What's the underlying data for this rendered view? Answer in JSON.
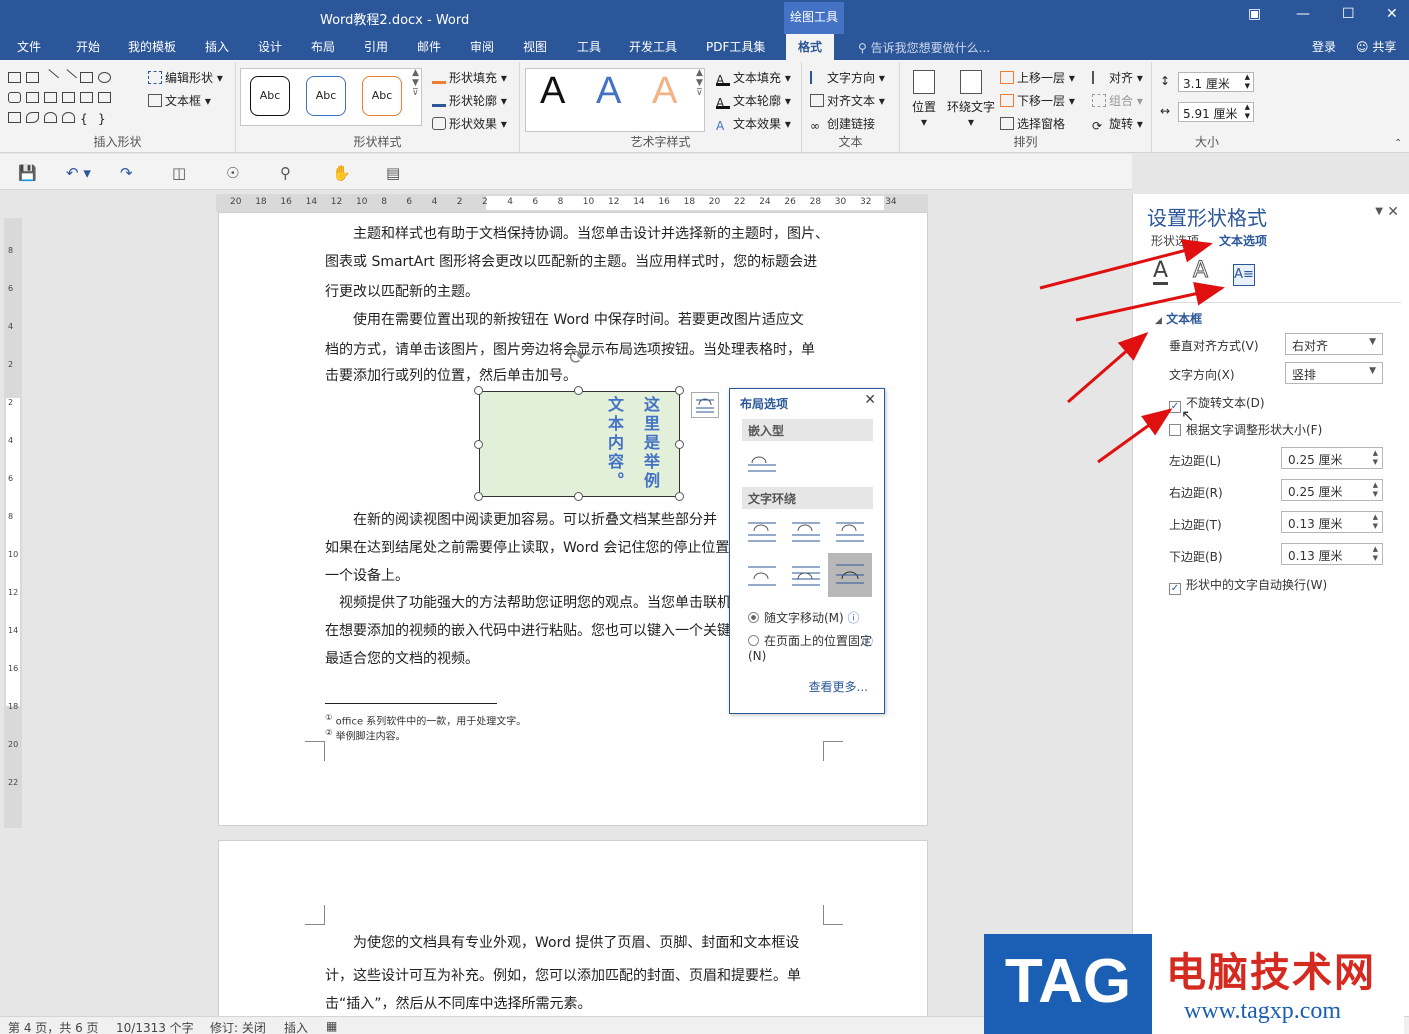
{
  "window": {
    "title": "Word教程2.docx - Word",
    "context_tab": "绘图工具",
    "controls": [
      "restore-ribbon",
      "minimize",
      "maximize",
      "close"
    ]
  },
  "tabs": [
    "文件",
    "开始",
    "我的模板",
    "插入",
    "设计",
    "布局",
    "引用",
    "邮件",
    "审阅",
    "视图",
    "工具",
    "开发工具",
    "PDF工具集",
    "格式"
  ],
  "active_tab": "格式",
  "tell_me": "告诉我您想要做什么...",
  "account": {
    "login": "登录",
    "share": "共享"
  },
  "ribbon": {
    "insert_shapes": {
      "label": "插入形状",
      "edit_shape": "编辑形状",
      "text_box": "文本框"
    },
    "shape_styles": {
      "label": "形状样式",
      "sample": "Abc",
      "fill": "形状填充",
      "outline": "形状轮廓",
      "effects": "形状效果"
    },
    "wordart": {
      "label": "艺术字样式",
      "sample": "A",
      "fill": "文本填充",
      "outline": "文本轮廓",
      "effects": "文本效果"
    },
    "text": {
      "label": "文本",
      "direction": "文字方向",
      "align": "对齐文本",
      "link": "创建链接"
    },
    "arrange": {
      "label": "排列",
      "position": "位置",
      "wrap": "环绕文字",
      "forward": "上移一层",
      "backward": "下移一层",
      "pane": "选择窗格",
      "align": "对齐",
      "group": "组合",
      "rotate": "旋转"
    },
    "size": {
      "label": "大小",
      "height": "3.1 厘米",
      "width": "5.91 厘米"
    }
  },
  "ruler": {
    "h_numbers": [
      "20",
      "18",
      "16",
      "14",
      "12",
      "10",
      "8",
      "6",
      "4",
      "2",
      "2",
      "4",
      "6",
      "8",
      "10",
      "12",
      "14",
      "16",
      "18",
      "20",
      "22",
      "24",
      "26",
      "28",
      "30",
      "32",
      "34"
    ],
    "v_numbers": [
      "8",
      "6",
      "4",
      "2",
      "2",
      "4",
      "6",
      "8",
      "10",
      "12",
      "14",
      "16",
      "18",
      "20",
      "22"
    ]
  },
  "document": {
    "page1": {
      "lines": [
        "主题和样式也有助于文档保持协调。当您单击设计并选择新的主题时，图片、",
        "图表或 SmartArt 图形将会更改以匹配新的主题。当应用样式时，您的标题会进",
        "行更改以匹配新的主题。",
        "使用在需要位置出现的新按钮在 Word 中保存时间。若要更改图片适应文",
        "档的方式，请单击该图片，图片旁边将会显示布局选项按钮。当处理表格时，单",
        "击要添加行或列的位置，然后单击加号。",
        "在新的阅读视图中阅读更加容易。可以折叠文档某些部分并",
        "如果在达到结尾处之前需要停止读取，Word 会记住您的停止位置",
        "一个设备上。",
        "视频提供了功能强大的方法帮助您证明您的观点。当您单击联机",
        "在想要添加的视频的嵌入代码中进行粘贴。您也可以键入一个关键",
        "最适合您的文档的视频。"
      ],
      "footnotes": [
        "office 系列软件中的一款，用于处理文字。",
        "举例脚注内容。"
      ],
      "textbox": {
        "col1": "这里是举例",
        "col2": "文本内容。"
      }
    },
    "page2": {
      "lines": [
        "为使您的文档具有专业外观，Word 提供了页眉、页脚、封面和文本框设",
        "计，这些设计可互为补充。例如，您可以添加匹配的封面、页眉和提要栏。单",
        "击“插入”，然后从不同库中选择所需元素。"
      ]
    }
  },
  "layout_options": {
    "title": "布局选项",
    "inline_section": "嵌入型",
    "wrap_section": "文字环绕",
    "move_with_text": "随文字移动(M)",
    "fix_position": "在页面上的位置固定(N)",
    "see_more": "查看更多..."
  },
  "format_pane": {
    "title": "设置形状格式",
    "tabs": [
      "形状选项",
      "文本选项"
    ],
    "active_tab": "文本选项",
    "section": "文本框",
    "vertical_align_label": "垂直对齐方式(V)",
    "vertical_align_value": "右对齐",
    "text_direction_label": "文字方向(X)",
    "text_direction_value": "竖排",
    "no_rotate_label": "不旋转文本(D)",
    "no_rotate_checked": true,
    "resize_label": "根据文字调整形状大小(F)",
    "resize_checked": false,
    "left_margin_label": "左边距(L)",
    "left_margin": "0.25 厘米",
    "right_margin_label": "右边距(R)",
    "right_margin": "0.25 厘米",
    "top_margin_label": "上边距(T)",
    "top_margin": "0.13 厘米",
    "bottom_margin_label": "下边距(B)",
    "bottom_margin": "0.13 厘米",
    "wrap_label": "形状中的文字自动换行(W)",
    "wrap_checked": true
  },
  "status": {
    "page": "第 4 页，共 6 页",
    "words": "10/1313 个字",
    "revisions": "修订: 关闭",
    "mode": "插入"
  },
  "watermark": {
    "tag": "TAG",
    "site_name": "电脑技术网",
    "url": "www.tagxp.com"
  },
  "colors": {
    "brand": "#2b579a",
    "textbox_fill": "#e2efd9",
    "textbox_text": "#4472c4",
    "arrow": "#e01010"
  }
}
